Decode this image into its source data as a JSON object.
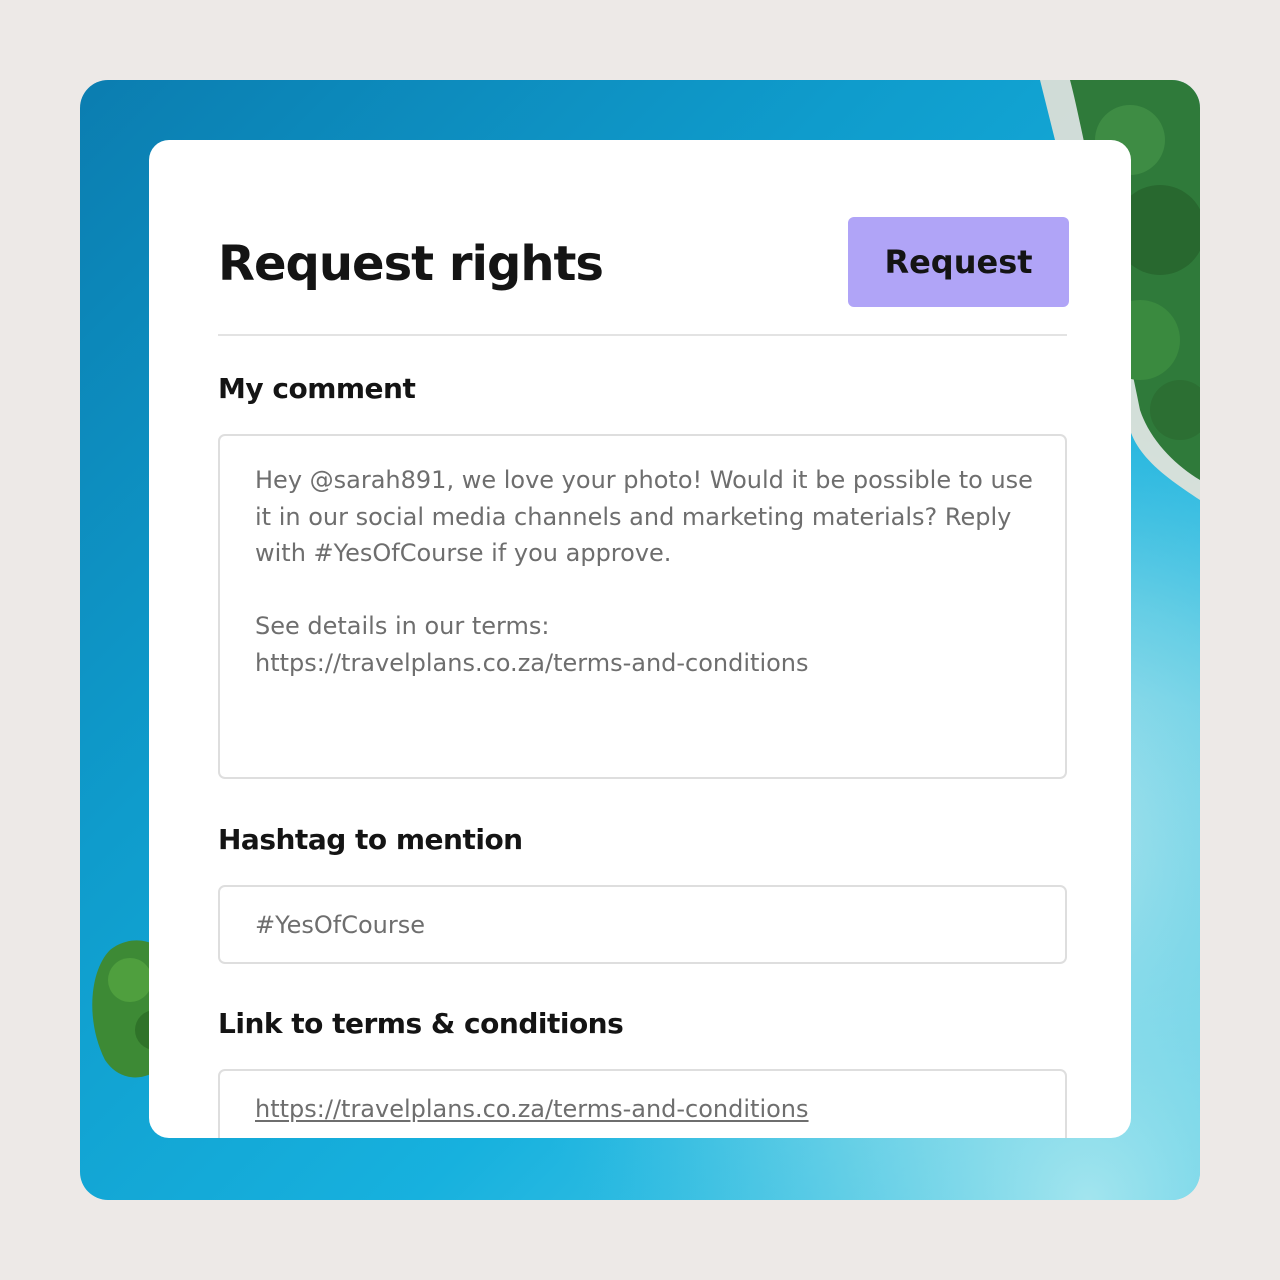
{
  "colors": {
    "page_background": "#ede9e7",
    "card_background": "#ffffff",
    "accent_button": "#b0a4f7",
    "heading_text": "#141414",
    "field_text": "#6e6e6e",
    "border": "#dedede"
  },
  "backdrop": {
    "icon": "aerial-ocean-island-photo"
  },
  "dialog": {
    "title": "Request rights",
    "request_button_label": "Request"
  },
  "comment": {
    "label": "My comment",
    "value": "Hey @sarah891, we love your photo! Would it be possible to use it in our social media channels and marketing materials? Reply with #YesOfCourse if you approve.\n\nSee details in our terms:\nhttps://travelplans.co.za/terms-and-conditions"
  },
  "hashtag": {
    "label": "Hashtag to mention",
    "value": "#YesOfCourse"
  },
  "terms_link": {
    "label": "Link to terms & conditions",
    "value": "https://travelplans.co.za/terms-and-conditions"
  }
}
